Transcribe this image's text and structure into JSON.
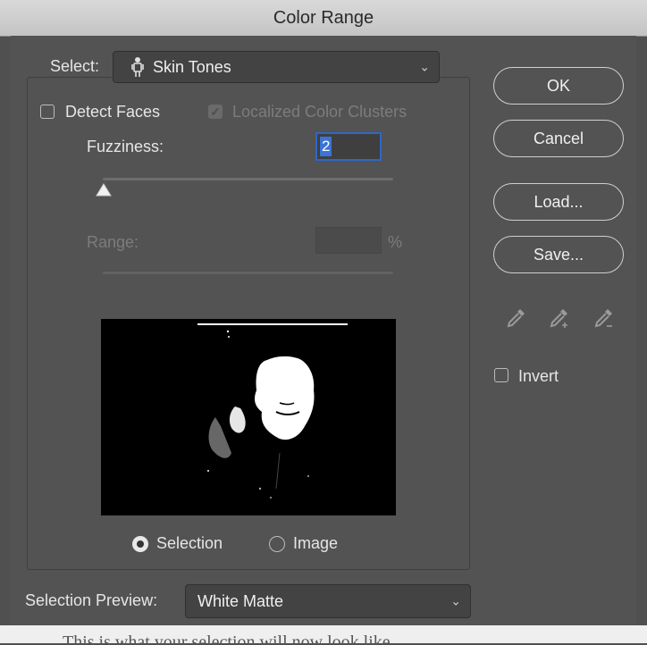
{
  "window": {
    "title": "Color Range"
  },
  "select": {
    "label": "Select:",
    "value": "Skin Tones",
    "icon": "person-icon"
  },
  "detect_faces": {
    "label": "Detect Faces",
    "checked": false
  },
  "localized_clusters": {
    "label": "Localized Color Clusters",
    "checked": true,
    "disabled": true
  },
  "fuzziness": {
    "label": "Fuzziness:",
    "value": "2",
    "slider_fraction": 0.0
  },
  "range": {
    "label": "Range:",
    "value": "",
    "unit": "%"
  },
  "buttons": {
    "ok": "OK",
    "cancel": "Cancel",
    "load": "Load...",
    "save": "Save..."
  },
  "eyedroppers": [
    "eyedropper-icon",
    "eyedropper-plus-icon",
    "eyedropper-minus-icon"
  ],
  "invert": {
    "label": "Invert",
    "checked": false
  },
  "view_mode": {
    "selection_label": "Selection",
    "image_label": "Image",
    "selected": "Selection"
  },
  "selection_preview": {
    "label": "Selection Preview:",
    "value": "White Matte"
  },
  "colors": {
    "accent": "#3a74d6",
    "panel": "#535353",
    "titlebar": "#c8c8c8"
  },
  "background_text": "This is what your selection will now look like"
}
